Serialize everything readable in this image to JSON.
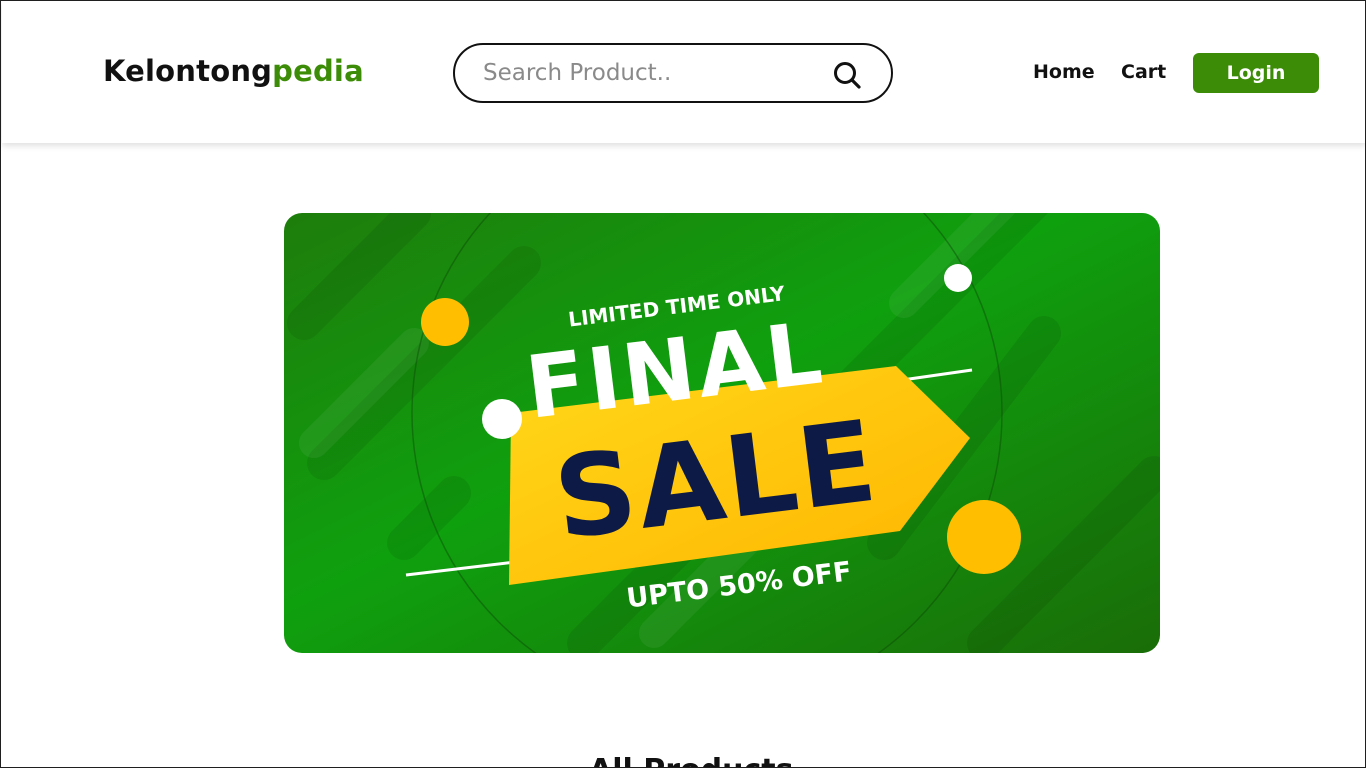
{
  "header": {
    "logo": {
      "part1": "Kelontong",
      "part2": "pedia"
    },
    "search": {
      "placeholder": "Search Product..",
      "value": ""
    },
    "nav": {
      "home": "Home",
      "cart": "Cart"
    },
    "login_label": "Login"
  },
  "banner": {
    "top_text": "LIMITED TIME ONLY",
    "word1": "FINAL",
    "word2": "SALE",
    "bottom_text": "UPTO 50% OFF"
  },
  "section": {
    "partial_heading": "All Products"
  },
  "colors": {
    "brand_green": "#3d8c08",
    "banner_green": "#12a010",
    "sale_yellow": "#ffc20e",
    "sale_navy": "#0d1a45"
  }
}
